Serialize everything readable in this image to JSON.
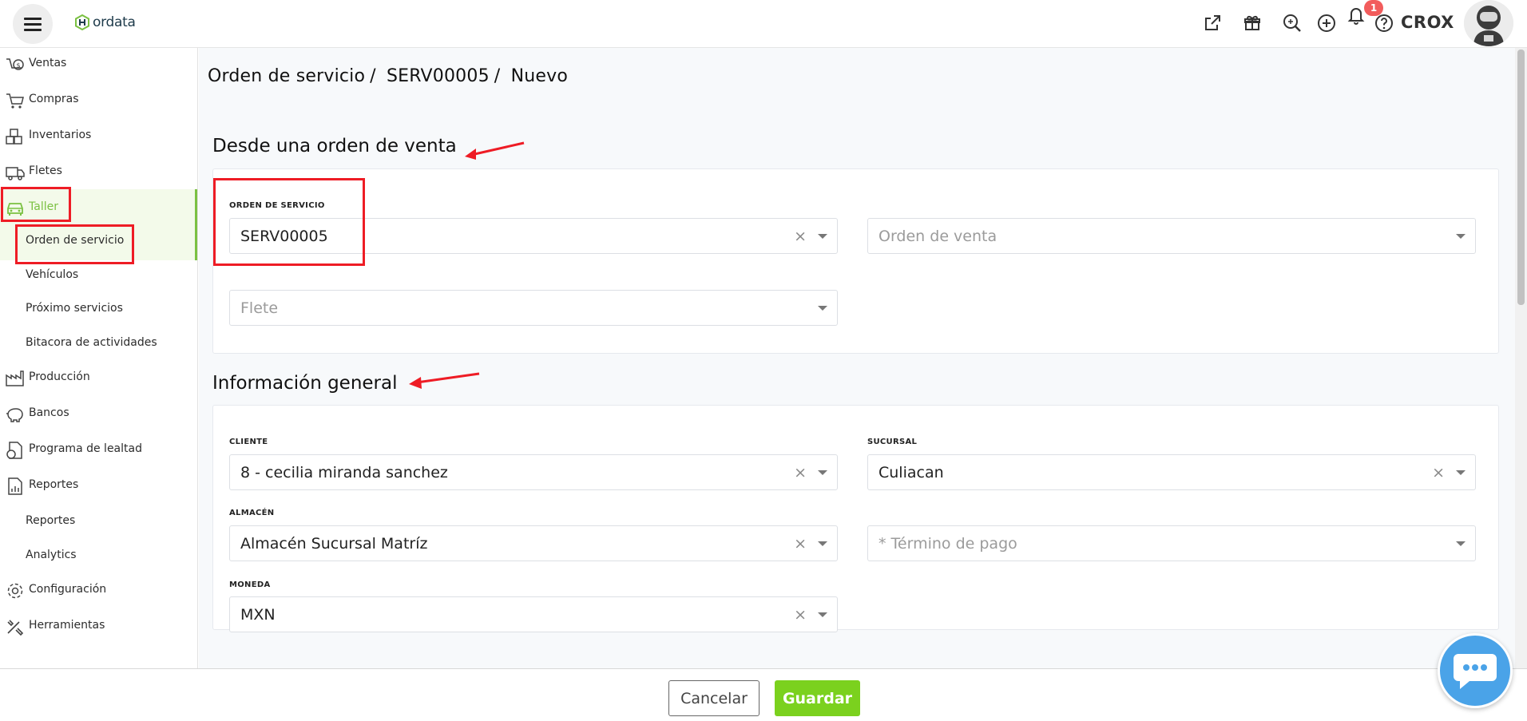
{
  "app": {
    "logo_text": "ordata",
    "user_name": "CROX",
    "notification_count": "1",
    "accent_color": "#7bc142",
    "save_color": "#7bd11e",
    "highlight_color": "#ee1c25"
  },
  "sidebar": {
    "items": [
      {
        "label": "Ventas",
        "icon": "sales-icon"
      },
      {
        "label": "Compras",
        "icon": "cart-icon"
      },
      {
        "label": "Inventarios",
        "icon": "boxes-icon"
      },
      {
        "label": "Fletes",
        "icon": "truck-icon"
      },
      {
        "label": "Taller",
        "icon": "car-icon"
      },
      {
        "label": "Producción",
        "icon": "factory-icon"
      },
      {
        "label": "Bancos",
        "icon": "piggy-bank-icon"
      },
      {
        "label": "Programa de lealtad",
        "icon": "loyalty-icon"
      },
      {
        "label": "Reportes",
        "icon": "report-icon"
      },
      {
        "label": "Configuración",
        "icon": "gear-icon"
      },
      {
        "label": "Herramientas",
        "icon": "tools-icon"
      }
    ],
    "taller_sub": [
      "Orden de servicio",
      "Vehículos",
      "Próximo servicios",
      "Bitacora de actividades"
    ],
    "reportes_sub": [
      "Reportes",
      "Analytics"
    ]
  },
  "breadcrumb": [
    "Orden de servicio",
    "SERV00005",
    "Nuevo"
  ],
  "sections": {
    "from_sale_title": "Desde una orden de venta",
    "general_title": "Información general"
  },
  "from_sale": {
    "orden_servicio_label": "ORDEN DE SERVICIO",
    "orden_servicio_value": "SERV00005",
    "orden_venta_placeholder": "Orden de venta",
    "flete_placeholder": "Flete"
  },
  "general": {
    "cliente_label": "CLIENTE",
    "cliente_value": "8 - cecilia miranda sanchez",
    "sucursal_label": "SUCURSAL",
    "sucursal_value": "Culiacan",
    "almacen_label": "ALMACÉN",
    "almacen_value": "Almacén Sucursal Matríz",
    "termino_placeholder": "* Término de pago",
    "moneda_label": "MONEDA",
    "moneda_value": "MXN"
  },
  "footer": {
    "cancel_label": "Cancelar",
    "save_label": "Guardar"
  },
  "clear_glyph": "×"
}
